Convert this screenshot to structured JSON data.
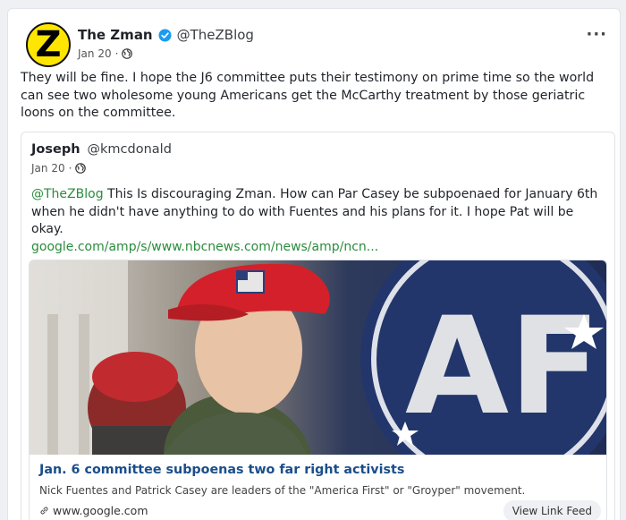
{
  "post": {
    "avatar_letter": "Z",
    "author_name": "The Zman",
    "author_handle": "@TheZBlog",
    "date": "Jan 20",
    "separator": "·",
    "more_label": "···",
    "text": "They will be fine. I hope the J6 committee puts their testimony on prime time so the world can see two wholesome young Americans get the McCarthy treatment by those geriatric loons on the committee.",
    "icons": [
      "verified-badge-icon",
      "globe-icon",
      "more-options-icon"
    ]
  },
  "quote": {
    "author_name": "Joseph",
    "author_handle": "@kmcdonald",
    "date": "Jan 20",
    "separator": "·",
    "mention": "@TheZBlog",
    "text": " This Is discouraging Zman. How can Par Casey be subpoenaed for January 6th when he didn't have anything to do with Fuentes and his plans for it. I hope Pat will be okay.",
    "link": "google.com/amp/s/www.nbcnews.com/news/amp/ncn..."
  },
  "link_card": {
    "title": "Jan. 6 committee subpoenas two far right activists",
    "description": "Nick Fuentes and Patrick Casey are leaders of the \"America First\" or \"Groyper\" movement.",
    "domain": "www.google.com",
    "view_button": "View Link Feed",
    "image_text": "AF"
  },
  "colors": {
    "accent_link": "#2a8c3c",
    "title_link": "#1a4e8a",
    "verified": "#1d9bf0",
    "avatar_bg": "#ffe600"
  }
}
